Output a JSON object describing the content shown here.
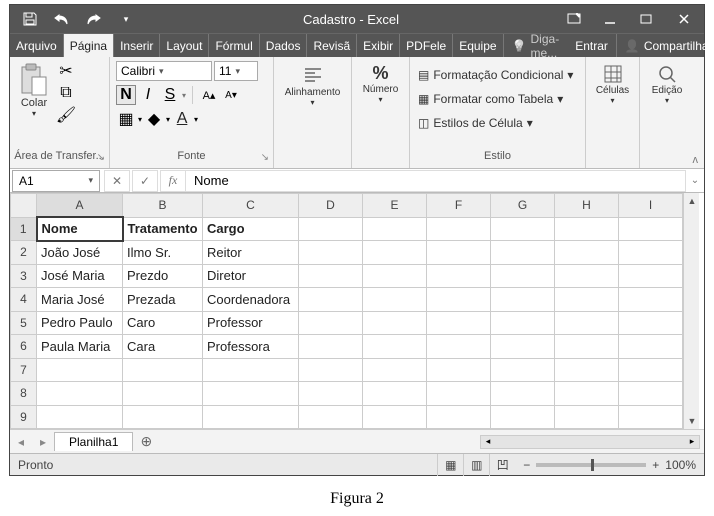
{
  "title": "Cadastro - Excel",
  "caption": "Figura 2",
  "tabs": {
    "file": "Arquivo",
    "home": "Página",
    "insert": "Inserir",
    "layout": "Layout",
    "formulas": "Fórmul",
    "data": "Dados",
    "review": "Revisã",
    "view": "Exibir",
    "pdf": "PDFele",
    "team": "Equipe",
    "tellme": "Diga-me...",
    "signin": "Entrar",
    "share": "Compartilhar"
  },
  "ribbon": {
    "clipboard": {
      "paste": "Colar",
      "label": "Área de Transfer..."
    },
    "font": {
      "name": "Calibri",
      "size": "11",
      "label": "Fonte"
    },
    "alignment": {
      "label": "Alinhamento"
    },
    "number": {
      "label": "Número",
      "symbol": "%"
    },
    "styles": {
      "cond": "Formatação Condicional",
      "table": "Formatar como Tabela",
      "cell": "Estilos de Célula",
      "label": "Estilo"
    },
    "cells": {
      "label": "Células"
    },
    "editing": {
      "label": "Edição"
    }
  },
  "formulaBar": {
    "nameBox": "A1",
    "formula": "Nome"
  },
  "sheet": {
    "columns": [
      "A",
      "B",
      "C",
      "D",
      "E",
      "F",
      "G",
      "H",
      "I"
    ],
    "rowCount": 9,
    "headers": [
      "Nome",
      "Tratamento",
      "Cargo"
    ],
    "rows": [
      [
        "João José",
        "Ilmo Sr.",
        "Reitor"
      ],
      [
        "José Maria",
        "Prezdo",
        "Diretor"
      ],
      [
        "Maria José",
        "Prezada",
        "Coordenadora"
      ],
      [
        "Pedro Paulo",
        "Caro",
        "Professor"
      ],
      [
        "Paula  Maria",
        "Cara",
        "Professora"
      ]
    ],
    "activeCell": "A1",
    "tab": "Planilha1"
  },
  "status": {
    "msg": "Pronto",
    "zoom": "100%"
  }
}
